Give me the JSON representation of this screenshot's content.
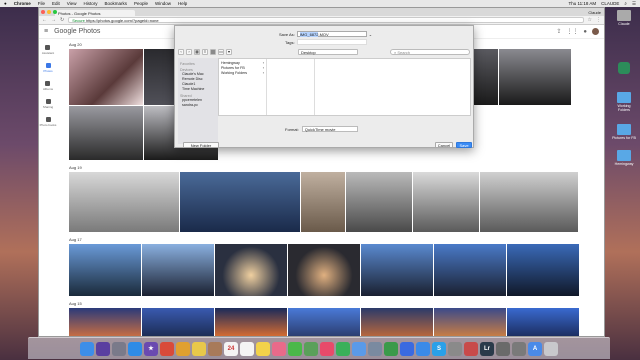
{
  "menubar": {
    "apple": "",
    "app_name": "Chrome",
    "items": [
      "File",
      "Edit",
      "View",
      "History",
      "Bookmarks",
      "People",
      "Window",
      "Help"
    ],
    "clock": "Thu 11:18 AM",
    "user": "CLAUDE"
  },
  "browser": {
    "tab_title": "Photos - Google Photos",
    "secure_label": "Secure",
    "url": "https://photos.google.com/?pageId=none",
    "profile_name": "Claude"
  },
  "photos_app": {
    "brand": "Google Photos",
    "nav": [
      {
        "label": "Assistant",
        "icon": "assistant-icon"
      },
      {
        "label": "Photos",
        "icon": "photos-icon"
      },
      {
        "label": "Albums",
        "icon": "albums-icon"
      },
      {
        "label": "Sharing",
        "icon": "sharing-icon"
      },
      {
        "label": "Photo books",
        "icon": "photobooks-icon"
      }
    ],
    "sections": [
      {
        "date": "Aug 20"
      },
      {
        "date": "Aug 19"
      },
      {
        "date": "Aug 17"
      },
      {
        "date": "Aug 15"
      }
    ]
  },
  "save_dialog": {
    "save_as_label": "Save As:",
    "save_as_value": "IMG_6872",
    "save_as_suffix": ".MOV",
    "tags_label": "Tags:",
    "location": "Desktop",
    "search_placeholder": "Search",
    "sidebar": {
      "favorites_header": "Favorites",
      "devices_header": "Devices",
      "shared_header": "Shared",
      "favorites": [],
      "devices": [
        "Claude's Mac",
        "Remote Disc",
        "Claude1",
        "Time Machine"
      ],
      "shared": [
        "ppcerretelen",
        "sandra-pc"
      ]
    },
    "column_items": [
      {
        "label": "Hemingway",
        "has_children": true,
        "selected": false
      },
      {
        "label": "Pictures for FB",
        "has_children": true,
        "selected": false
      },
      {
        "label": "Working Folders",
        "has_children": true,
        "selected": false
      }
    ],
    "format_label": "Format:",
    "format_value": "QuickTime movie",
    "new_folder_label": "New Folder",
    "cancel_label": "Cancel",
    "save_label": "Save"
  },
  "desktop_icons": [
    {
      "label": "Claude",
      "kind": "disk"
    },
    {
      "label": "",
      "kind": "app"
    },
    {
      "label": "Working Folders",
      "kind": "folder"
    },
    {
      "label": "Pictures for FB",
      "kind": "folder"
    },
    {
      "label": "Hemingway",
      "kind": "folder"
    }
  ],
  "dock": [
    {
      "name": "finder-icon",
      "color": "#3d8ee8",
      "glyph": ""
    },
    {
      "name": "siri-icon",
      "color": "#5a3fa0",
      "glyph": ""
    },
    {
      "name": "launchpad-icon",
      "color": "#7a7a8a",
      "glyph": ""
    },
    {
      "name": "safari-icon",
      "color": "#2e8be6",
      "glyph": ""
    },
    {
      "name": "imovie-icon",
      "color": "#6a4ab0",
      "glyph": "★"
    },
    {
      "name": "chrome-icon",
      "color": "#d94a3a",
      "glyph": ""
    },
    {
      "name": "photos-app-icon",
      "color": "#e0a030",
      "glyph": ""
    },
    {
      "name": "notes-icon",
      "color": "#e8c84a",
      "glyph": ""
    },
    {
      "name": "contacts-icon",
      "color": "#a87a5a",
      "glyph": ""
    },
    {
      "name": "calendar-icon",
      "color": "#f4f4f4",
      "glyph": "24"
    },
    {
      "name": "reminders-icon",
      "color": "#f4f4f4",
      "glyph": ""
    },
    {
      "name": "notes2-icon",
      "color": "#f2d24a",
      "glyph": ""
    },
    {
      "name": "photos-icon",
      "color": "#e86a8a",
      "glyph": ""
    },
    {
      "name": "messages-icon",
      "color": "#4ab84a",
      "glyph": ""
    },
    {
      "name": "maps-icon",
      "color": "#5aa05a",
      "glyph": ""
    },
    {
      "name": "music-icon",
      "color": "#e84a6a",
      "glyph": ""
    },
    {
      "name": "facetime-icon",
      "color": "#3ab05a",
      "glyph": ""
    },
    {
      "name": "mail-icon",
      "color": "#5a9ae8",
      "glyph": ""
    },
    {
      "name": "preview-icon",
      "color": "#7a8aa0",
      "glyph": ""
    },
    {
      "name": "numbers-icon",
      "color": "#3a9a4a",
      "glyph": ""
    },
    {
      "name": "keynote-icon",
      "color": "#3a6ae0",
      "glyph": ""
    },
    {
      "name": "appstore-icon",
      "color": "#3a8ae8",
      "glyph": ""
    },
    {
      "name": "skype-icon",
      "color": "#2aa0e8",
      "glyph": "S"
    },
    {
      "name": "sysprefs-icon",
      "color": "#8a8a8a",
      "glyph": ""
    },
    {
      "name": "misc-icon",
      "color": "#c84a4a",
      "glyph": ""
    },
    {
      "name": "lightroom-icon",
      "color": "#2a3a4a",
      "glyph": "Lr"
    },
    {
      "name": "scanner-icon",
      "color": "#6a6a6a",
      "glyph": ""
    },
    {
      "name": "utility-icon",
      "color": "#7a7a7a",
      "glyph": ""
    },
    {
      "name": "appstore2-icon",
      "color": "#4a8ae8",
      "glyph": "A"
    },
    {
      "name": "trash-icon",
      "color": "#c8c8cc",
      "glyph": ""
    }
  ],
  "colors": {
    "accent": "#3b78e7",
    "dialog_primary": "#3b8cf5"
  }
}
